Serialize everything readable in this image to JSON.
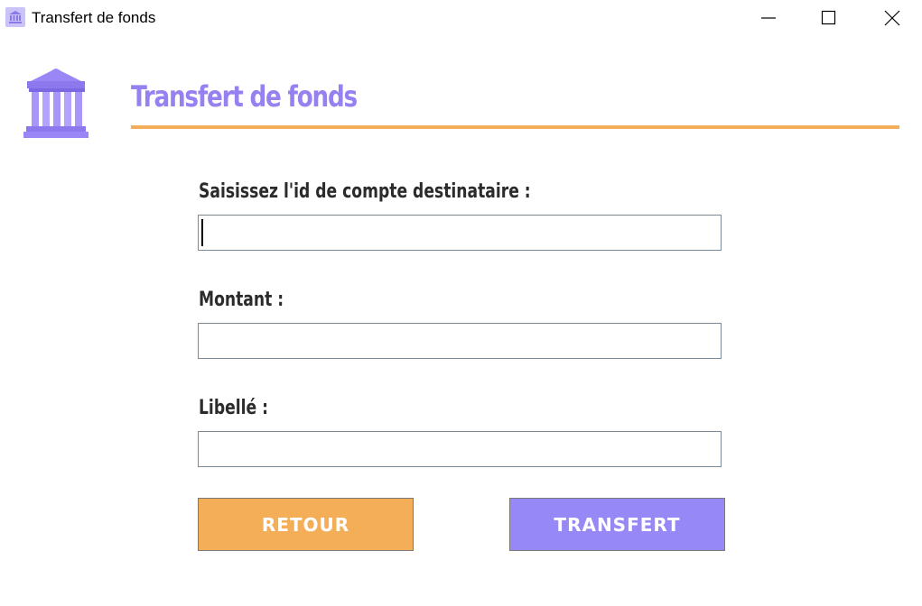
{
  "window": {
    "title": "Transfert de fonds",
    "icon": "bank-icon"
  },
  "header": {
    "title": "Transfert de fonds",
    "logo": "bank-building-icon",
    "accent_color": "#9781f0",
    "rule_color": "#f4ad58"
  },
  "form": {
    "account_label": "Saisissez l'id de compte destinataire :",
    "account_value": "",
    "amount_label": "Montant :",
    "amount_value": "",
    "label_label": "Libellé :",
    "label_value": ""
  },
  "buttons": {
    "back_label": "RETOUR",
    "back_color": "#f4ae58",
    "transfer_label": "TRANSFERT",
    "transfer_color": "#9788f8"
  }
}
